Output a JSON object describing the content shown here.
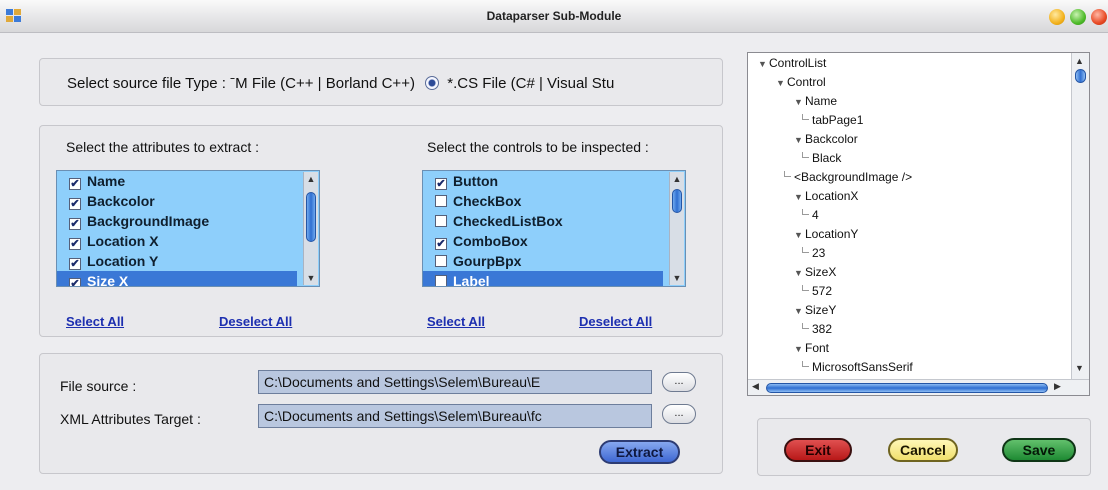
{
  "window": {
    "title": "Dataparser Sub-Module"
  },
  "source_type": {
    "label": "Select source file Type :",
    "option_fm": "ˉM File (C++ | Borland C++)",
    "option_cs": "*.CS File (C# | Visual Stu",
    "selected": "cs"
  },
  "attributes": {
    "label": "Select the attributes to extract :",
    "items": [
      {
        "label": "Name",
        "checked": true,
        "selected": false
      },
      {
        "label": "Backcolor",
        "checked": true,
        "selected": false
      },
      {
        "label": "BackgroundImage",
        "checked": true,
        "selected": false
      },
      {
        "label": "Location X",
        "checked": true,
        "selected": false
      },
      {
        "label": "Location Y",
        "checked": true,
        "selected": false
      },
      {
        "label": "Size X",
        "checked": true,
        "selected": true
      }
    ],
    "select_all": "Select All",
    "deselect_all": "Deselect All"
  },
  "controls": {
    "label": "Select the controls to be inspected :",
    "items": [
      {
        "label": "Button",
        "checked": true,
        "selected": false
      },
      {
        "label": "CheckBox",
        "checked": false,
        "selected": false
      },
      {
        "label": "CheckedListBox",
        "checked": false,
        "selected": false
      },
      {
        "label": "ComboBox",
        "checked": true,
        "selected": false
      },
      {
        "label": "GourpBpx",
        "checked": false,
        "selected": false
      },
      {
        "label": "Label",
        "checked": false,
        "selected": true
      }
    ],
    "select_all": "Select All",
    "deselect_all": "Deselect All"
  },
  "files": {
    "source_label": "File source :",
    "source_value": "C:\\Documents and Settings\\Selem\\Bureau\\E",
    "target_label": "XML Attributes Target :",
    "target_value": "C:\\Documents and Settings\\Selem\\Bureau\\fc",
    "browse_label": "...",
    "extract_label": "Extract"
  },
  "tree": {
    "nodes": [
      {
        "text": "ControlList",
        "level": 0,
        "expander": true
      },
      {
        "text": "Control",
        "level": 1,
        "expander": true
      },
      {
        "text": "Name",
        "level": 2,
        "expander": true
      },
      {
        "text": "tabPage1",
        "level": 3,
        "expander": false
      },
      {
        "text": "Backcolor",
        "level": 2,
        "expander": true
      },
      {
        "text": "Black",
        "level": 3,
        "expander": false
      },
      {
        "text": "<BackgroundImage />",
        "level": 2,
        "expander": false
      },
      {
        "text": "LocationX",
        "level": 2,
        "expander": true
      },
      {
        "text": "4",
        "level": 3,
        "expander": false
      },
      {
        "text": "LocationY",
        "level": 2,
        "expander": true
      },
      {
        "text": "23",
        "level": 3,
        "expander": false
      },
      {
        "text": "SizeX",
        "level": 2,
        "expander": true
      },
      {
        "text": "572",
        "level": 3,
        "expander": false
      },
      {
        "text": "SizeY",
        "level": 2,
        "expander": true
      },
      {
        "text": "382",
        "level": 3,
        "expander": false
      },
      {
        "text": "Font",
        "level": 2,
        "expander": true
      },
      {
        "text": "MicrosoftSansSerif",
        "level": 3,
        "expander": false
      }
    ]
  },
  "actions": {
    "exit_label": "Exit",
    "cancel_label": "Cancel",
    "save_label": "Save"
  },
  "colors": {
    "list_background": "#8ecffb",
    "selection": "#3a78d6",
    "link": "#1d2fb0",
    "exit": "#c42222",
    "cancel": "#f4e88a",
    "save": "#2e9a3f",
    "extract": "#4f78dc"
  }
}
